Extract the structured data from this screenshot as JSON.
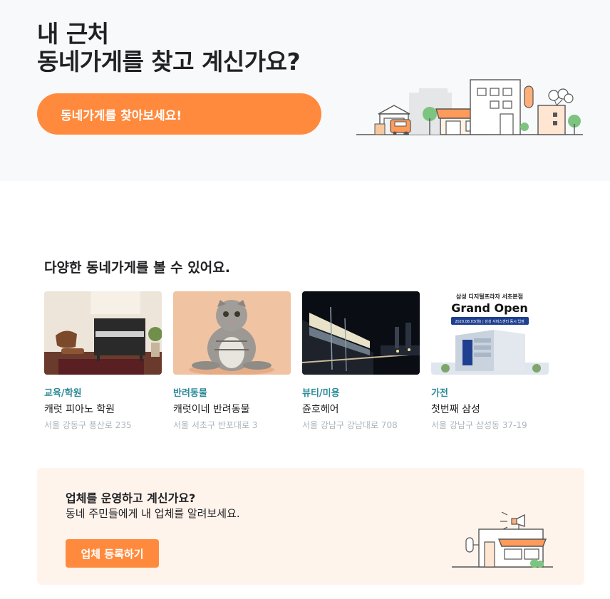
{
  "hero": {
    "title_line1": "내 근처",
    "title_line2": "동네가게를 찾고 계신가요?",
    "cta_label": "동네가게를 찾아보세요!"
  },
  "section": {
    "title": "다양한 동네가게를 볼 수 있어요."
  },
  "stores": [
    {
      "category": "교육/학원",
      "name": "캐럿 피아노 학원",
      "address": "서울 강동구 풍산로 235"
    },
    {
      "category": "반려동물",
      "name": "캐럿이네 반려동물",
      "address": "서울 서초구 반포대로 3"
    },
    {
      "category": "뷰티/미용",
      "name": "쥰호헤어",
      "address": "서울 강남구 강남대로 708"
    },
    {
      "category": "가전",
      "name": "첫번째 삼성",
      "address": "서울 강남구 삼성동 37-19",
      "poster": {
        "line1": "삼성 디지털프라자 서초본점",
        "headline": "Grand Open",
        "date_line": "2020.08.03(월) | 삼성 서비스센터 동시 입점"
      }
    }
  ],
  "business": {
    "title": "업체를 운영하고 계신가요?",
    "description": "동네 주민들에게 내 업체를 알려보세요.",
    "cta_label": "업체 등록하기"
  },
  "colors": {
    "accent": "#ff8a3d",
    "category_text": "#2c8a98",
    "hero_bg": "#f8f9fa",
    "biz_bg": "#fff4ec"
  }
}
